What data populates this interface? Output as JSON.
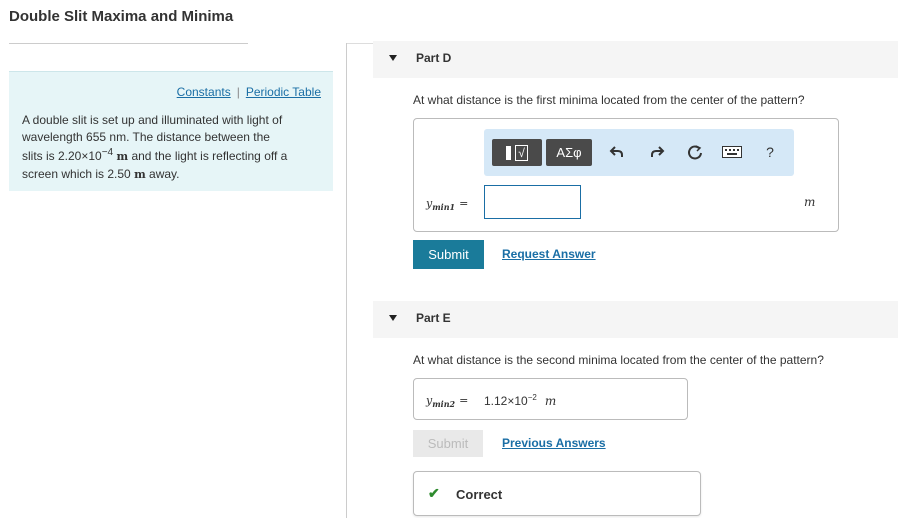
{
  "page": {
    "title": "Double Slit Maxima and Minima"
  },
  "info": {
    "links": [
      "Constants",
      "Periodic Table"
    ],
    "separator": "|",
    "text_line1": "A double slit is set up and illuminated with light of",
    "text_line2": "wavelength 655 nm.  The distance between the",
    "text_line3a": "slits is 2.20×10",
    "text_line3_exp": "−4",
    "text_line3_unit": "m",
    "text_line3b": " and the light is reflecting off a",
    "text_line4a": "screen which is 2.50 ",
    "text_line4_unit": "m",
    "text_line4b": " away."
  },
  "partD": {
    "label": "Part D",
    "question": "At what distance is the first minima located from the center of the pattern?",
    "toolbar": {
      "templates_label": "√",
      "symbols_label": "ΑΣφ",
      "help_label": "?"
    },
    "var_name": "y",
    "var_sub": "min1",
    "equals": "=",
    "input_value": "",
    "unit": "m",
    "submit_label": "Submit",
    "request_label": "Request Answer"
  },
  "partE": {
    "label": "Part E",
    "question": "At what distance is the second minima located from the center of the pattern?",
    "var_name": "y",
    "var_sub": "min2",
    "equals": "=",
    "value_base": "1.12×10",
    "value_exp": "−2",
    "unit": "m",
    "submit_label": "Submit",
    "previous_label": "Previous Answers",
    "status": "Correct"
  },
  "colors": {
    "accent": "#1a7b9a",
    "link": "#1a6ea5",
    "info_bg": "#e6f5f7",
    "toolbar_bg": "#d5e8f7",
    "correct": "#2e8b2e"
  }
}
